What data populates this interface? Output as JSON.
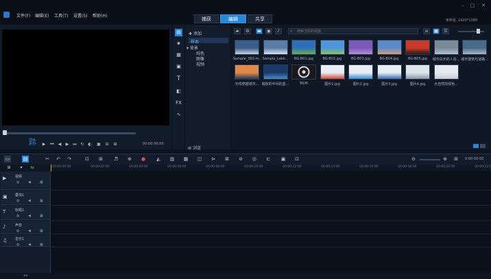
{
  "menu": [
    "文件(F)",
    "编辑(E)",
    "工具(T)",
    "设置(S)",
    "帮助(H)"
  ],
  "main_tabs": [
    "捕获",
    "编辑",
    "共享"
  ],
  "active_tab": "编辑",
  "project_info": "未命名, 1920*1080",
  "preview": {
    "mode_project": "项目-",
    "mode_clip": "素材-",
    "timecode": "00:00:00:00"
  },
  "folders": {
    "add": "添加",
    "items": [
      "样本",
      "背景",
      "纯色",
      "图像",
      "视频"
    ],
    "browse": "浏览"
  },
  "library": {
    "search_placeholder": "搜索当前的视图",
    "media": [
      {
        "label": "Sample_360.m...",
        "c1": "#3a5d8a",
        "c2": "#c8d4e0"
      },
      {
        "label": "Sample_Lake...",
        "c1": "#5a7da8",
        "c2": "#d8e2ec"
      },
      {
        "label": "BG-B01.jpg",
        "c1": "#2f6fb8",
        "c2": "#6fb04a"
      },
      {
        "label": "BG-B02.jpg",
        "c1": "#4f96d8",
        "c2": "#8bc462"
      },
      {
        "label": "BG-B03.jpg",
        "c1": "#7a5ab8",
        "c2": "#b88ad0"
      },
      {
        "label": "BG-B04.jpg",
        "c1": "#5a8ac8",
        "c2": "#d4a07a"
      },
      {
        "label": "BG-B05.jpg",
        "c1": "#c83a2a",
        "c2": "#2a1a18"
      },
      {
        "label": "城市白天的人造...",
        "c1": "#7a8a9a",
        "c2": "#b8c4cc"
      },
      {
        "label": "城市建筑与道路...",
        "c1": "#4a6a8a",
        "c2": "#a8b8c4"
      },
      {
        "label": "光线穿越城市...",
        "c1": "#e08a4a",
        "c2": "#2a3a5a"
      },
      {
        "label": "缩放的中间的蓝...",
        "c1": "#1a3a6a",
        "c2": "#4a8ac8"
      },
      {
        "label": "BGM",
        "c1": "#1a1a1a",
        "c2": "#1a1a1a"
      },
      {
        "label": "图片1.jpg",
        "c1": "#e8eef4",
        "c2": "#d04a3a"
      },
      {
        "label": "图片2.jpg",
        "c1": "#e8eef4",
        "c2": "#3a8ad0"
      },
      {
        "label": "图片3.jpg",
        "c1": "#e8eef4",
        "c2": "#3a6ab0"
      },
      {
        "label": "图片4.jpg",
        "c1": "#dce4ec",
        "c2": "#8a9aaa"
      },
      {
        "label": "大自然的绿色...",
        "c1": "#e4eaf0",
        "c2": "#c4ccd4"
      }
    ]
  },
  "ruler": [
    "00:00:00:00",
    "00:00:02:00",
    "00:00:04:00",
    "00:00:06:00",
    "00:00:08:00",
    "00:00:10:00",
    "00:00:12:00",
    "00:00:14:00",
    "00:00:16:00",
    "00:00:18:00",
    "00:00:20:00",
    "00:00:22:00"
  ],
  "tracks": [
    {
      "name": "视频",
      "icon": "▶"
    },
    {
      "name": "叠加1",
      "icon": "▣"
    },
    {
      "name": "标题1",
      "icon": "T"
    },
    {
      "name": "声音",
      "icon": "♪"
    },
    {
      "name": "音乐1",
      "icon": "♫"
    }
  ],
  "zoom_time": "0:00:00:00"
}
